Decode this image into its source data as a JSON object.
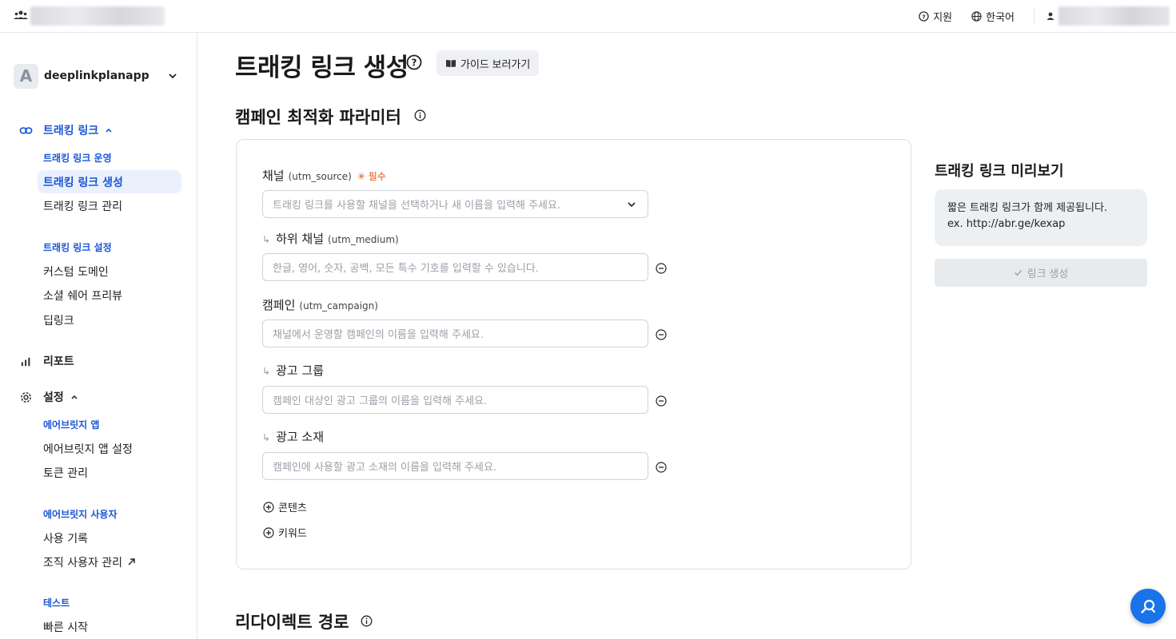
{
  "topbar": {
    "support_label": "지원",
    "language_label": "한국어"
  },
  "sidebar": {
    "app_avatar_letter": "A",
    "app_name": "deeplinkplanapp",
    "tracking": {
      "label": "트래킹 링크",
      "section_operate": "트래킹 링크 운영",
      "items_operate": [
        "트래킹 링크 생성",
        "트래킹 링크 관리"
      ],
      "section_settings": "트래킹 링크 설정",
      "items_settings": [
        "커스텀 도메인",
        "소셜 쉐어 프리뷰",
        "딥링크"
      ]
    },
    "report_label": "리포트",
    "settings": {
      "label": "설정",
      "section_app": "에어브릿지 앱",
      "items_app": [
        "에어브릿지 앱 설정",
        "토큰 관리"
      ],
      "section_user": "에어브릿지 사용자",
      "items_user": [
        "사용 기록",
        "조직 사용자 관리"
      ],
      "section_test": "테스트",
      "items_test": [
        "빠른 시작"
      ]
    }
  },
  "main": {
    "page_title": "트래킹 링크 생성",
    "guide_button": "가이드 보러가기",
    "campaign_section_title": "캠페인 최적화 파라미터",
    "fields": {
      "channel": {
        "label": "채널",
        "param": "(utm_source)",
        "required": "필수",
        "placeholder": "트래킹 링크를 사용할 채널을 선택하거나 새 이름을 입력해 주세요."
      },
      "sub_channel": {
        "label": "하위 채널",
        "param": "(utm_medium)",
        "placeholder": "한글, 영어, 숫자, 공백, 모든 특수 기호를 입력할 수 있습니다."
      },
      "campaign": {
        "label": "캠페인",
        "param": "(utm_campaign)",
        "placeholder": "채널에서 운영할 캠페인의 이름을 입력해 주세요."
      },
      "ad_group": {
        "label": "광고 그룹",
        "placeholder": "캠페인 대상인 광고 그룹의 이름을 입력해 주세요."
      },
      "ad_creative": {
        "label": "광고 소재",
        "placeholder": "캠페인에 사용할 광고 소재의 이름을 입력해 주세요."
      }
    },
    "add_content": "콘텐츠",
    "add_keyword": "키워드",
    "redirect_section_title": "리다이렉트 경로",
    "preview": {
      "title": "트래킹 링크 미리보기",
      "line1": "짧은 트래킹 링크가 함께 제공됩니다.",
      "line2": "ex. http://abr.ge/kexap",
      "create_button": "링크 생성"
    }
  },
  "colors": {
    "accent": "#1a56d6",
    "active_bg": "#eaf1fd",
    "required": "#e5530e",
    "fab": "#1a73e8"
  }
}
